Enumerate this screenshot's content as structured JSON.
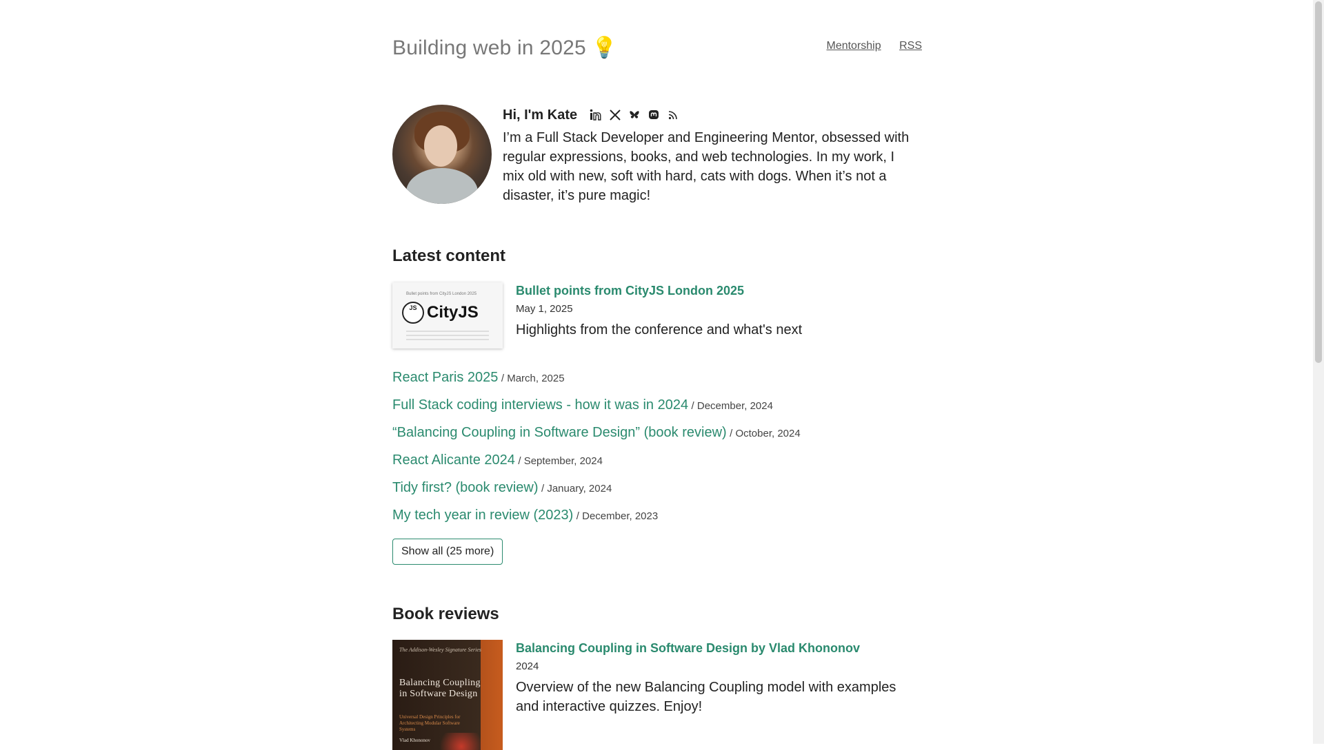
{
  "site": {
    "title": "Building web in 2025",
    "title_emoji": "💡",
    "nav": [
      "Mentorship",
      "RSS"
    ]
  },
  "intro": {
    "greeting": "Hi, I'm Kate",
    "social_icons": [
      "linkedin-icon",
      "x-icon",
      "bluesky-icon",
      "mastodon-icon",
      "rss-icon"
    ],
    "bio": "I’m a Full Stack Developer and Engineering Mentor, obsessed with regular expressions, books, and web technologies. In my work, I mix old with new, soft with hard, cats with dogs. When it’s not a disaster, it’s pure magic!"
  },
  "latest": {
    "heading": "Latest content",
    "featured": {
      "title": "Bullet points from CityJS London 2025",
      "date": "May 1, 2025",
      "description": "Highlights from the conference and what's next",
      "thumb_caption": "Bullet points from CityJS London 2025",
      "thumb_badge": "JS",
      "thumb_logo": "CityJS"
    },
    "items": [
      {
        "title": "React Paris 2025",
        "date": "/ March, 2025"
      },
      {
        "title": "Full Stack coding interviews - how it was in 2024",
        "date": "/ December, 2024"
      },
      {
        "title": "“Balancing Coupling in Software Design” (book review)",
        "date": "/ October, 2024"
      },
      {
        "title": "React Alicante 2024",
        "date": "/ September, 2024"
      },
      {
        "title": "Tidy first? (book review)",
        "date": "/ January, 2024"
      },
      {
        "title": "My tech year in review (2023)",
        "date": "/ December, 2023"
      }
    ],
    "show_all": "Show all (25 more)"
  },
  "books": {
    "heading": "Book reviews",
    "items": [
      {
        "title": "Balancing Coupling in Software Design by Vlad Khononov",
        "year": "2024",
        "description": "Overview of the new Balancing Coupling model with examples and interactive quizzes. Enjoy!",
        "cover": {
          "series": "The Addison-Wesley Signature Series",
          "title": "Balancing Coupling in Software Design",
          "subtitle": "Universal Design Principles for Architecting Modular Software Systems",
          "author": "Vlad Khononov"
        }
      }
    ]
  },
  "colors": {
    "link": "#2a8a6e",
    "text": "#222222",
    "muted": "#777777"
  }
}
